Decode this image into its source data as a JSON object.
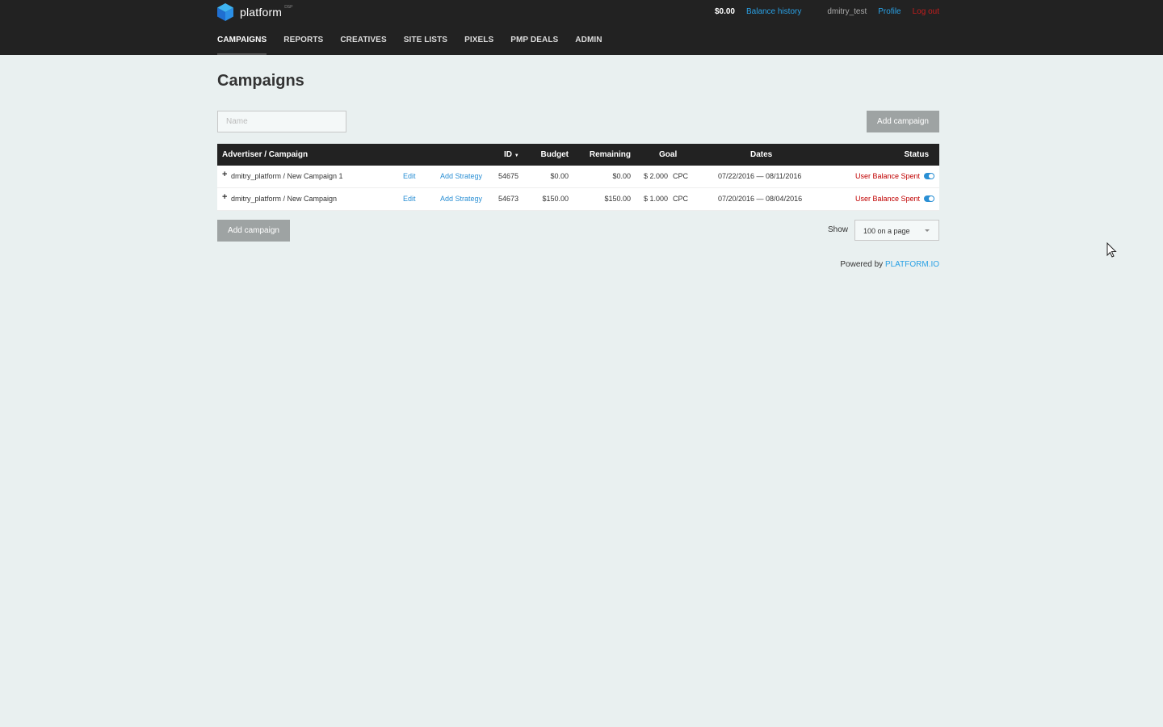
{
  "app": {
    "logo_text": "platform",
    "logo_sup": "DSP"
  },
  "header": {
    "balance": "$0.00",
    "balance_history": "Balance history",
    "username": "dmitry_test",
    "profile": "Profile",
    "logout": "Log out"
  },
  "nav": {
    "items": [
      {
        "label": "CAMPAIGNS",
        "active": true
      },
      {
        "label": "REPORTS"
      },
      {
        "label": "CREATIVES"
      },
      {
        "label": "SITE LISTS"
      },
      {
        "label": "PIXELS"
      },
      {
        "label": "PMP DEALS"
      },
      {
        "label": "ADMIN"
      }
    ]
  },
  "page": {
    "title": "Campaigns",
    "name_placeholder": "Name",
    "add_campaign": "Add campaign"
  },
  "table": {
    "headers": {
      "campaign": "Advertiser / Campaign",
      "id": "ID",
      "sort_arrow": "▼",
      "budget": "Budget",
      "remaining": "Remaining",
      "goal": "Goal",
      "dates": "Dates",
      "status": "Status"
    },
    "rows": [
      {
        "expand": "+",
        "campaign": "dmitry_platform / New Campaign 1",
        "edit": "Edit",
        "add_strategy": "Add Strategy",
        "id": "54675",
        "budget": "$0.00",
        "remaining": "$0.00",
        "goal": "$ 2.000",
        "goal_type": "CPC",
        "dates": "07/22/2016 — 08/11/2016",
        "status": "User Balance Spent"
      },
      {
        "expand": "+",
        "campaign": "dmitry_platform / New Campaign",
        "edit": "Edit",
        "add_strategy": "Add Strategy",
        "id": "54673",
        "budget": "$150.00",
        "remaining": "$150.00",
        "goal": "$ 1.000",
        "goal_type": "CPC",
        "dates": "07/20/2016 — 08/04/2016",
        "status": "User Balance Spent"
      }
    ]
  },
  "pagination": {
    "show_label": "Show",
    "per_page": "100 on a page"
  },
  "footer": {
    "powered_by": "Powered by",
    "brand": "PLATFORM.IO"
  },
  "colors": {
    "topbar": "#222222",
    "link": "#2aa1e5",
    "status_red": "#c00000",
    "background": "#e9f0f0"
  }
}
